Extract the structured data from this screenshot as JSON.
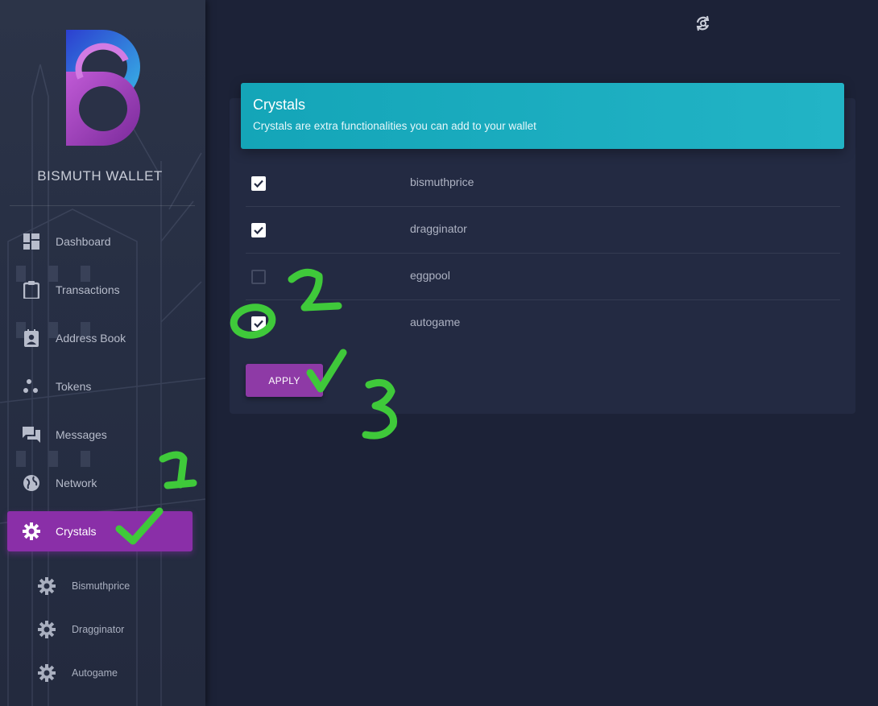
{
  "app": {
    "brand": "BISMUTH WALLET"
  },
  "sidebar": {
    "items": [
      {
        "label": "Dashboard",
        "icon": "dashboard-icon"
      },
      {
        "label": "Transactions",
        "icon": "clipboard-icon"
      },
      {
        "label": "Address Book",
        "icon": "contact-card-icon"
      },
      {
        "label": "Tokens",
        "icon": "tokens-icon"
      },
      {
        "label": "Messages",
        "icon": "chat-icon"
      },
      {
        "label": "Network",
        "icon": "globe-icon"
      },
      {
        "label": "Crystals",
        "icon": "gear-icon",
        "active": true
      }
    ],
    "sub_items": [
      {
        "label": "Bismuthprice",
        "icon": "gear-icon"
      },
      {
        "label": "Dragginator",
        "icon": "gear-icon"
      },
      {
        "label": "Autogame",
        "icon": "gear-icon"
      }
    ]
  },
  "topbar": {
    "refresh_icon": "refresh-search-icon"
  },
  "card": {
    "title": "Crystals",
    "subtitle": "Crystals are extra functionalities you can add to your wallet",
    "crystals": [
      {
        "name": "bismuthprice",
        "checked": true
      },
      {
        "name": "dragginator",
        "checked": true
      },
      {
        "name": "eggpool",
        "checked": false
      },
      {
        "name": "autogame",
        "checked": true
      }
    ],
    "apply_label": "APPLY"
  },
  "annotations": {
    "color": "#3fc93a",
    "steps": [
      "1",
      "2",
      "3"
    ]
  },
  "colors": {
    "accent": "#8a2fa8",
    "header": "#18abbe",
    "background": "#1c2237"
  }
}
